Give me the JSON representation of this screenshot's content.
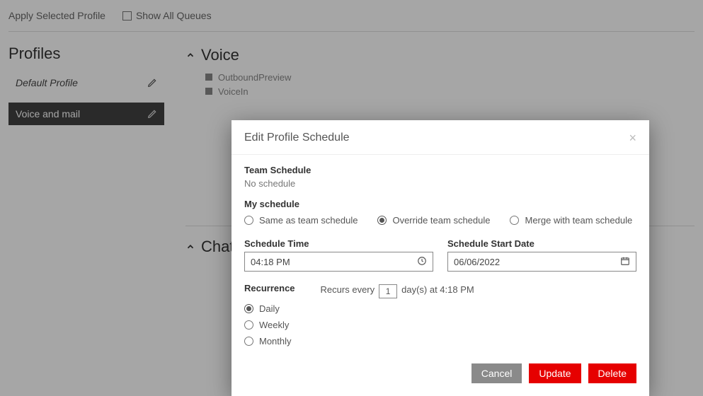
{
  "topbar": {
    "apply_link": "Apply Selected Profile",
    "show_all": "Show All Queues"
  },
  "sidebar": {
    "heading": "Profiles",
    "items": [
      {
        "label": "Default Profile"
      },
      {
        "label": "Voice and mail"
      }
    ]
  },
  "main": {
    "voice": {
      "title": "Voice",
      "queues": [
        "OutboundPreview",
        "VoiceIn"
      ]
    },
    "chat": {
      "title": "Chat"
    }
  },
  "modal": {
    "title": "Edit Profile Schedule",
    "team_label": "Team Schedule",
    "team_value": "No schedule",
    "my_label": "My schedule",
    "options": {
      "same": "Same as team schedule",
      "override": "Override team schedule",
      "merge": "Merge with team schedule"
    },
    "time_label": "Schedule Time",
    "time_value": "04:18  PM",
    "date_label": "Schedule Start Date",
    "date_value": "06/06/2022",
    "recurrence_label": "Recurrence",
    "recurrence": {
      "daily": "Daily",
      "weekly": "Weekly",
      "monthly": "Monthly"
    },
    "recurs_pre": "Recurs every",
    "recurs_value": "1",
    "recurs_post": "day(s) at 4:18 PM",
    "buttons": {
      "cancel": "Cancel",
      "update": "Update",
      "delete": "Delete"
    }
  }
}
